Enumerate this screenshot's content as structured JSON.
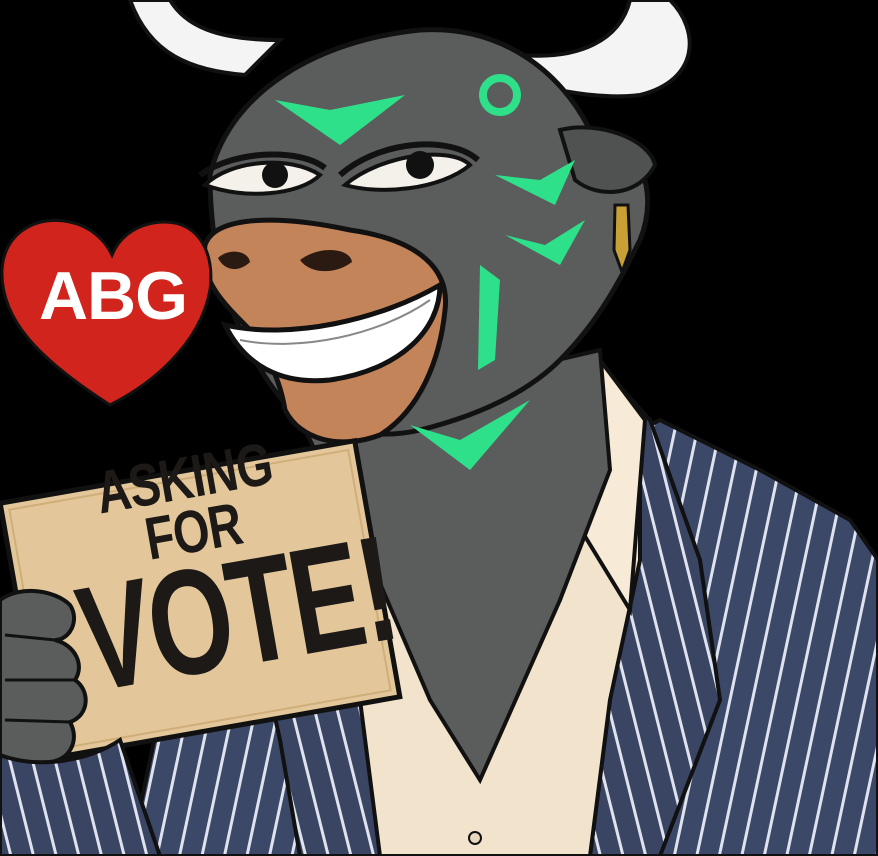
{
  "image": {
    "subject": "bull-mascot",
    "colors": {
      "background": "#000000",
      "skin": "#5a5d5c",
      "accent_green": "#2fe08a",
      "muzzle": "#c4845a",
      "horn": "#f4f4f4",
      "heart": "#d0241c",
      "sign_paper": "#e3c79a",
      "suit": "#3c4868",
      "shirt": "#f2e3cc"
    }
  },
  "heart_badge": {
    "label": "ABG"
  },
  "sign": {
    "line1": "ASKING FOR",
    "line2": "VOTE!"
  }
}
